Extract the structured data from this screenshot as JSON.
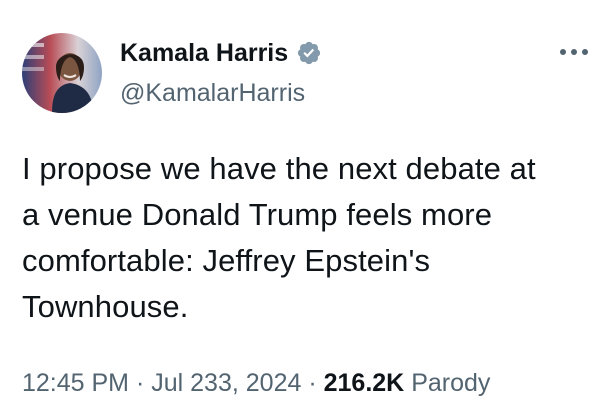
{
  "author": {
    "display_name": "Kamala Harris",
    "handle": "@KamalarHarris",
    "verified": true,
    "verified_color": "#829aab"
  },
  "tweet": {
    "text": "I propose we have the next debate at\na venue Donald Trump feels more\ncomfortable: Jeffrey Epstein's\nTownhouse."
  },
  "meta": {
    "time": "12:45 PM",
    "separator": "·",
    "date": "Jul 233, 2024",
    "views_count": "216.2K",
    "label": "Parody"
  },
  "icons": {
    "more": "more-horizontal-icon",
    "verified": "verified-badge-icon"
  }
}
